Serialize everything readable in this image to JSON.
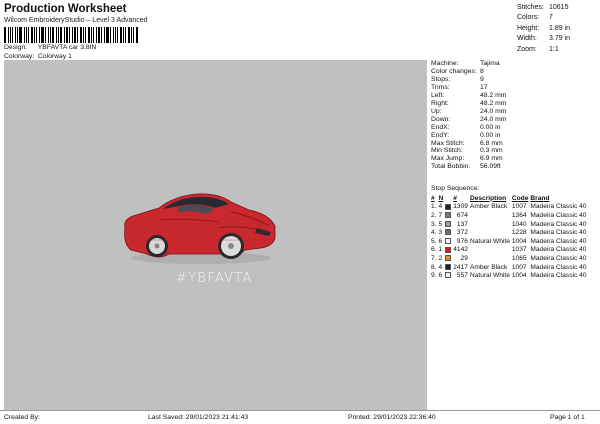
{
  "header": {
    "title": "Production Worksheet",
    "subtitle": "Wilcom EmbroideryStudio – Level 3 Advanced",
    "design_label": "Design:",
    "design_value": "YBFAVTA car 3,8IN",
    "colorway_label": "Colorway:",
    "colorway_value": "Colorway 1"
  },
  "summary": [
    {
      "k": "Stitches:",
      "v": "10615"
    },
    {
      "k": "Colors:",
      "v": "7"
    },
    {
      "k": "Height:",
      "v": "1.89 in"
    },
    {
      "k": "Width:",
      "v": "3.79 in"
    },
    {
      "k": "Zoom:",
      "v": "1:1"
    }
  ],
  "machine_info": [
    {
      "k": "Machine:",
      "v": "Tajima"
    },
    {
      "k": "Color changes:",
      "v": "8"
    },
    {
      "k": "Stops:",
      "v": "9"
    },
    {
      "k": "Trims:",
      "v": "17"
    },
    {
      "k": "Left:",
      "v": "48.2 mm"
    },
    {
      "k": "Right:",
      "v": "48.2 mm"
    },
    {
      "k": "Up:",
      "v": "24.0 mm"
    },
    {
      "k": "Down:",
      "v": "24.0 mm"
    },
    {
      "k": "EndX:",
      "v": "0.00 in"
    },
    {
      "k": "EndY:",
      "v": "0.00 in"
    },
    {
      "k": "Max Stitch:",
      "v": "6.8 mm"
    },
    {
      "k": "Min Stitch:",
      "v": "0.3 mm"
    },
    {
      "k": "Max Jump:",
      "v": "6.9 mm"
    },
    {
      "k": "Total Bobbin:",
      "v": "56.09ft"
    }
  ],
  "stop_sequence": {
    "title": "Stop Sequence:",
    "headers": [
      "#",
      "N",
      "",
      "#",
      "Description",
      "Code",
      "Brand"
    ],
    "rows": [
      {
        "i": "1.",
        "n": "4",
        "color": "#1a1f2b",
        "num": "1309",
        "desc": "Amber Black",
        "code": "1007",
        "brand": "Madeira Classic 40"
      },
      {
        "i": "2.",
        "n": "7",
        "color": "#6d7b86",
        "num": "674",
        "desc": "",
        "code": "1364",
        "brand": "Madeira Classic 40"
      },
      {
        "i": "3.",
        "n": "5",
        "color": "#9b9b9b",
        "num": "137",
        "desc": "",
        "code": "1040",
        "brand": "Madeira Classic 40"
      },
      {
        "i": "4.",
        "n": "3",
        "color": "#6b6b6b",
        "num": "372",
        "desc": "",
        "code": "1228",
        "brand": "Madeira Classic 40"
      },
      {
        "i": "5.",
        "n": "6",
        "color": "#f4f1ea",
        "num": "976",
        "desc": "Natural White",
        "code": "1004",
        "brand": "Madeira Classic 40"
      },
      {
        "i": "6.",
        "n": "1",
        "color": "#d42020",
        "num": "4142",
        "desc": "",
        "code": "1037",
        "brand": "Madeira Classic 40"
      },
      {
        "i": "7.",
        "n": "2",
        "color": "#e88a2a",
        "num": "29",
        "desc": "",
        "code": "1065",
        "brand": "Madeira Classic 40"
      },
      {
        "i": "8.",
        "n": "4",
        "color": "#1a1f2b",
        "num": "2417",
        "desc": "Amber Black",
        "code": "1007",
        "brand": "Madeira Classic 40"
      },
      {
        "i": "9.",
        "n": "6",
        "color": "#f4f1ea",
        "num": "557",
        "desc": "Natural White",
        "code": "1004",
        "brand": "Madeira Classic 40"
      }
    ]
  },
  "design": {
    "text": "#YBFAVTA",
    "background": "#c0c0c0",
    "car_color": "#c8282e"
  },
  "footer": {
    "created_by": "Created By:",
    "last_saved": "Last Saved: 29/01/2023 21:41:43",
    "printed": "Printed: 29/01/2023 22:36:40",
    "page": "Page 1 of 1"
  }
}
